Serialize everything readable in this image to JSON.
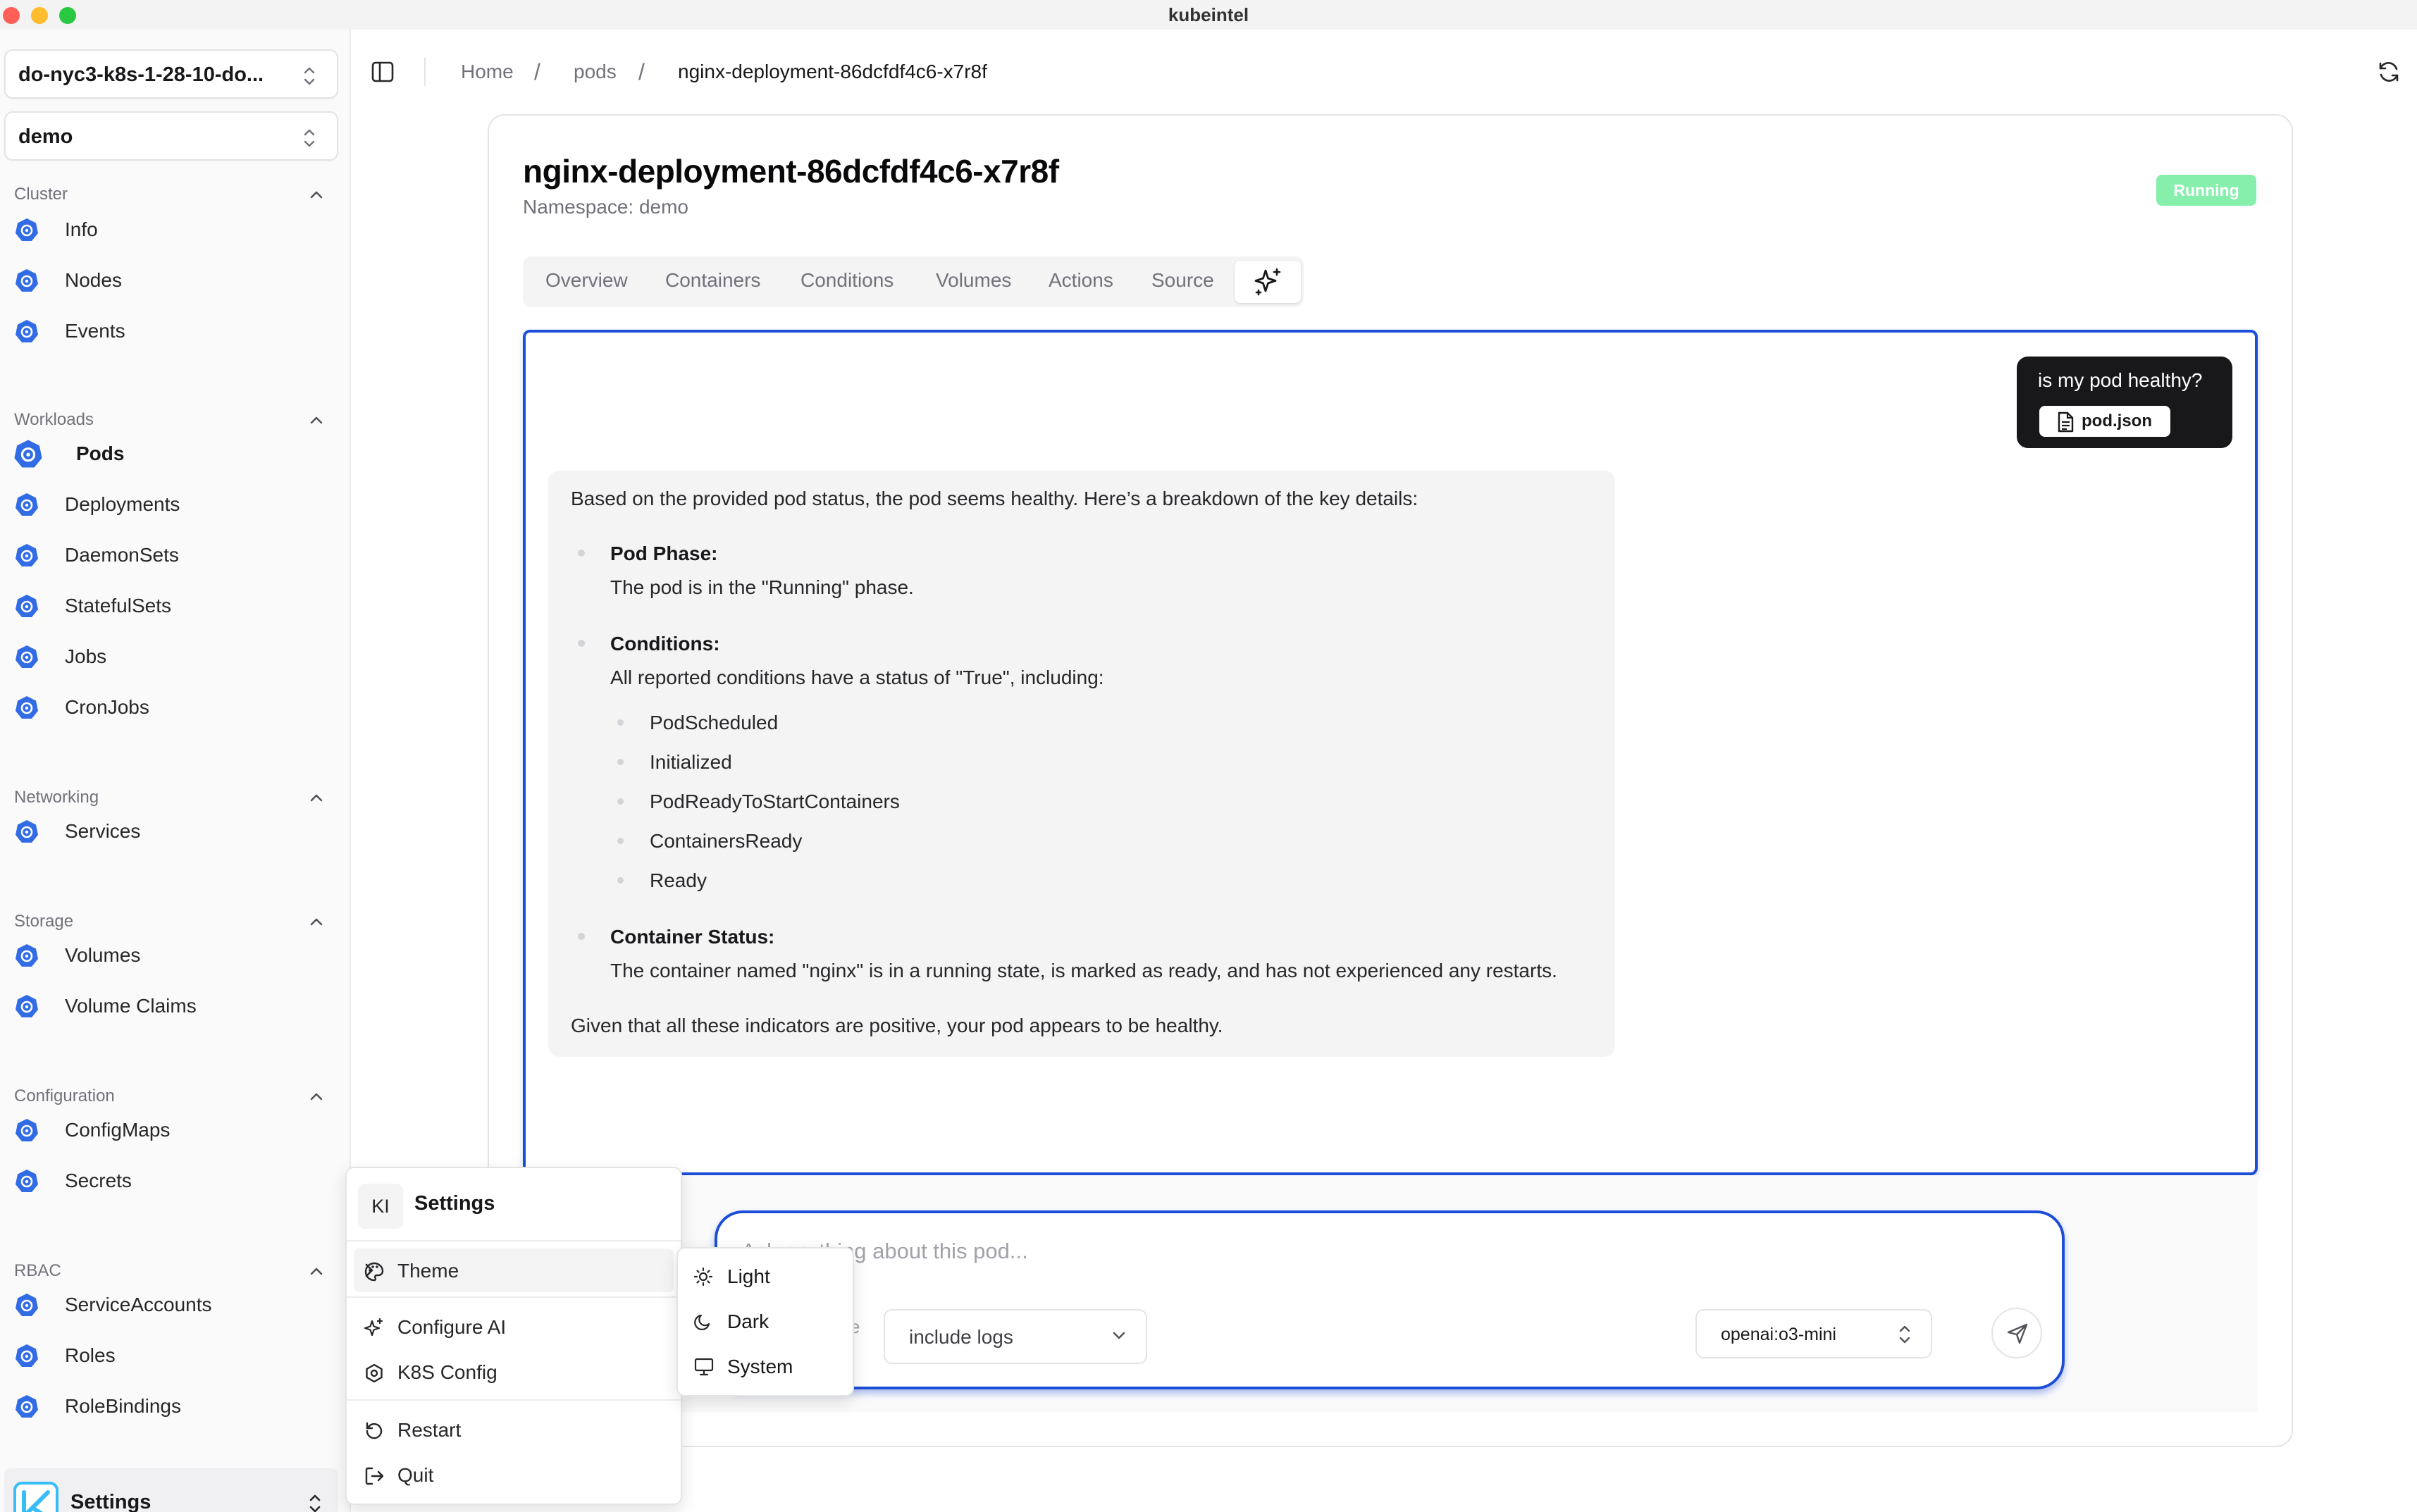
{
  "app": {
    "title": "kubeintel"
  },
  "sidebar": {
    "cluster_selector": "do-nyc3-k8s-1-28-10-do...",
    "namespace_selector": "demo",
    "groups": [
      {
        "label": "Cluster",
        "items": [
          {
            "label": "Info"
          },
          {
            "label": "Nodes"
          },
          {
            "label": "Events"
          }
        ]
      },
      {
        "label": "Workloads",
        "items": [
          {
            "label": "Pods",
            "active": true
          },
          {
            "label": "Deployments"
          },
          {
            "label": "DaemonSets"
          },
          {
            "label": "StatefulSets"
          },
          {
            "label": "Jobs"
          },
          {
            "label": "CronJobs"
          }
        ]
      },
      {
        "label": "Networking",
        "items": [
          {
            "label": "Services"
          }
        ]
      },
      {
        "label": "Storage",
        "items": [
          {
            "label": "Volumes"
          },
          {
            "label": "Volume Claims"
          }
        ]
      },
      {
        "label": "Configuration",
        "items": [
          {
            "label": "ConfigMaps"
          },
          {
            "label": "Secrets"
          }
        ]
      },
      {
        "label": "RBAC",
        "items": [
          {
            "label": "ServiceAccounts"
          },
          {
            "label": "Roles"
          },
          {
            "label": "RoleBindings"
          }
        ]
      }
    ],
    "footer_label": "Settings",
    "accent_color": "#326ce5"
  },
  "breadcrumb": {
    "home": "Home",
    "section": "pods",
    "current": "nginx-deployment-86dcfdf4c6-x7r8f"
  },
  "pod": {
    "name": "nginx-deployment-86dcfdf4c6-x7r8f",
    "namespace_label": "Namespace: demo",
    "status": "Running",
    "status_color": "#86efac"
  },
  "tabs": [
    "Overview",
    "Containers",
    "Conditions",
    "Volumes",
    "Actions",
    "Source"
  ],
  "chat": {
    "user_question": "is my pod healthy?",
    "attachment": "pod.json",
    "answer": {
      "intro": "Based on the provided pod status, the pod seems healthy. Here’s a breakdown of the key details:",
      "phase_title": "Pod Phase:",
      "phase_text": "The pod is in the \"Running\" phase.",
      "conditions_title": "Conditions:",
      "conditions_text": "All reported conditions have a status of \"True\", including:",
      "conditions": [
        "PodScheduled",
        "Initialized",
        "PodReadyToStartContainers",
        "ContainersReady",
        "Ready"
      ],
      "container_title": "Container Status:",
      "container_text": "The container named \"nginx\" is in a running state, is marked as ready, and has not experienced any restarts.",
      "conclusion": "Given that all these indicators are positive, your pod appears to be healthy."
    },
    "input_placeholder": "Ask anything about this pod...",
    "include_logs": "include logs",
    "model": "openai:o3-mini",
    "partial_hidden_text": "e"
  },
  "settings_menu": {
    "badge": "KI",
    "title": "Settings",
    "items": {
      "theme": "Theme",
      "configure_ai": "Configure AI",
      "k8s_config": "K8S Config",
      "restart": "Restart",
      "quit": "Quit"
    },
    "theme_options": [
      "Light",
      "Dark",
      "System"
    ]
  }
}
